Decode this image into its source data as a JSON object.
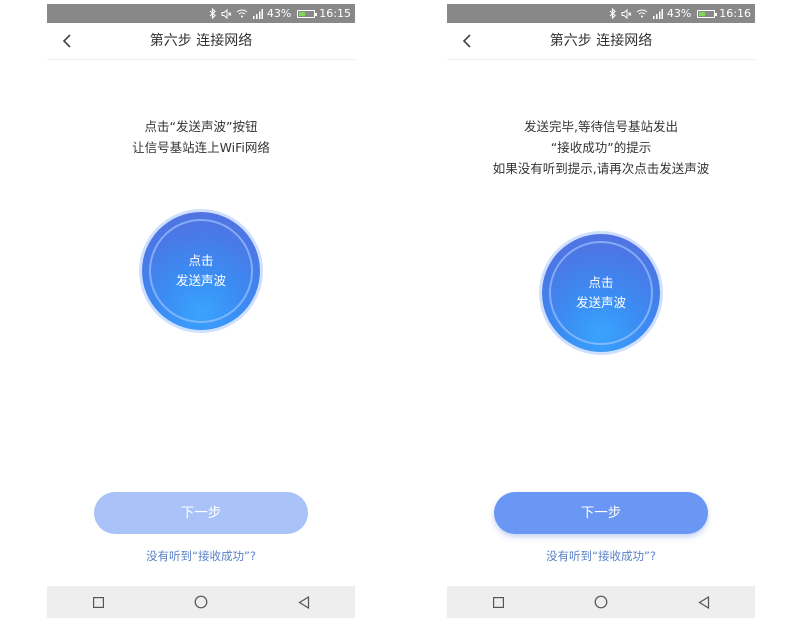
{
  "screens": [
    {
      "status": {
        "battery": "43%",
        "time": "16:15",
        "battery_level": 0.43
      },
      "title": "第六步 连接网络",
      "instructions": [
        "点击“发送声波”按钮",
        "让信号基站连上WiFi网络"
      ],
      "wave_button": {
        "line1": "点击",
        "line2": "发送声波"
      },
      "next_button": {
        "label": "下一步",
        "state": "disabled"
      },
      "help_link": "没有听到“接收成功”?"
    },
    {
      "status": {
        "battery": "43%",
        "time": "16:16",
        "battery_level": 0.43
      },
      "title": "第六步 连接网络",
      "instructions": [
        "发送完毕,等待信号基站发出",
        "“接收成功”的提示",
        "如果没有听到提示,请再次点击发送声波"
      ],
      "wave_button": {
        "line1": "点击",
        "line2": "发送声波"
      },
      "next_button": {
        "label": "下一步",
        "state": "enabled"
      },
      "help_link": "没有听到“接收成功”?"
    }
  ],
  "colors": {
    "status_bar": "#888888",
    "primary": "#6a96f4",
    "primary_disabled": "#a9c2f7",
    "link": "#5a7fc6",
    "wave_gradient": [
      "#3aa3ff",
      "#5a6fe0"
    ]
  },
  "icons": {
    "back": "chevron-left-icon",
    "bluetooth": "bluetooth-icon",
    "mute": "vibrate-mute-icon",
    "wifi": "wifi-icon",
    "signal": "cellular-signal-icon",
    "battery": "battery-icon",
    "nav_recent": "square-icon",
    "nav_home": "circle-icon",
    "nav_back": "triangle-back-icon"
  }
}
